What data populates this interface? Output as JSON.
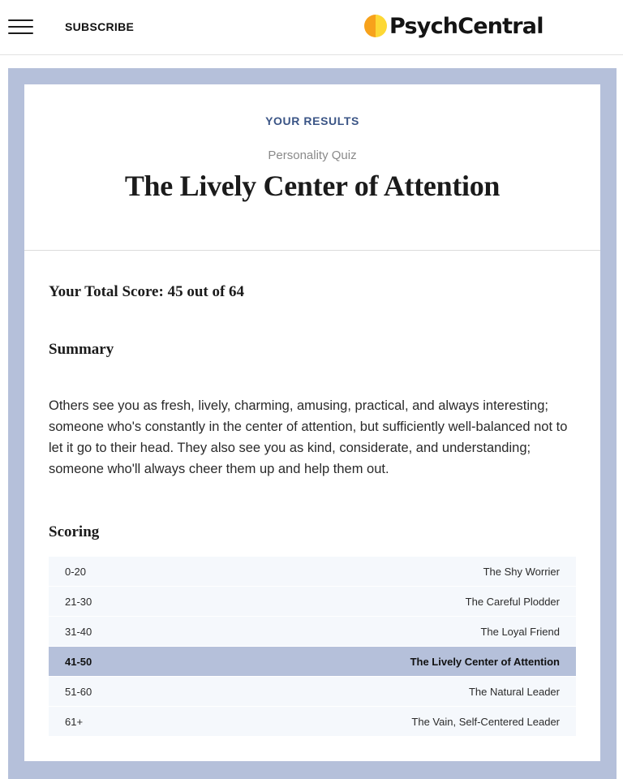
{
  "header": {
    "menu_icon": "hamburger-menu-icon",
    "subscribe_label": "SUBSCRIBE",
    "logo_text": "PsychCentral",
    "logo_colors": {
      "left": "#f7a21b",
      "right": "#fdd835"
    }
  },
  "results": {
    "eyebrow": "YOUR RESULTS",
    "quiz_type": "Personality Quiz",
    "title": "The Lively Center of Attention",
    "total_score_text": "Your Total Score: 45 out of 64",
    "score": 45,
    "score_max": 64
  },
  "summary": {
    "heading": "Summary",
    "text": "Others see you as fresh, lively, charming, amusing, practical, and always interesting; someone who's constantly in the center of attention, but sufficiently well-balanced not to let it go to their head. They also see you as kind, considerate, and understanding; someone who'll always cheer them up and help them out."
  },
  "scoring": {
    "heading": "Scoring",
    "rows": [
      {
        "range": "0-20",
        "label": "The Shy Worrier",
        "active": false
      },
      {
        "range": "21-30",
        "label": "The Careful Plodder",
        "active": false
      },
      {
        "range": "31-40",
        "label": "The Loyal Friend",
        "active": false
      },
      {
        "range": "41-50",
        "label": "The Lively Center of Attention",
        "active": true
      },
      {
        "range": "51-60",
        "label": "The Natural Leader",
        "active": false
      },
      {
        "range": "61+",
        "label": "The Vain, Self-Centered Leader",
        "active": false
      }
    ]
  },
  "colors": {
    "frame": "#b5c0da",
    "accent_text": "#3b5586",
    "row_bg": "#f5f8fc",
    "row_active_bg": "#b5c0da"
  }
}
